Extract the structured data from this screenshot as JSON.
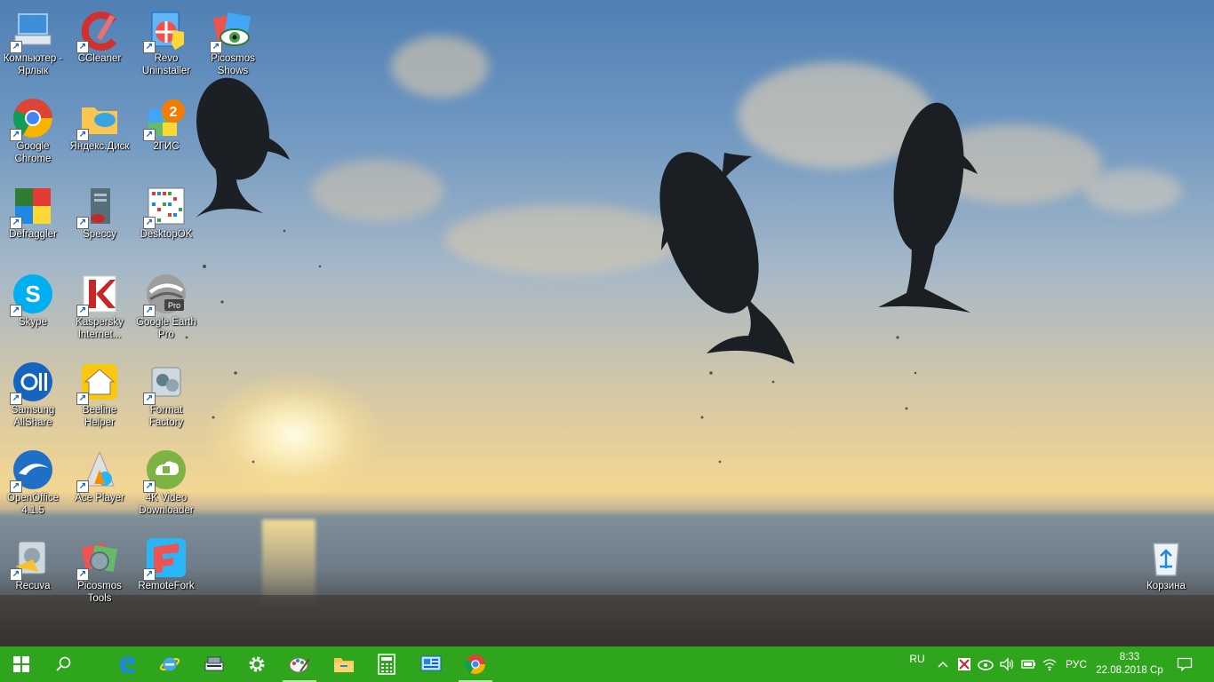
{
  "desktop": {
    "icons": [
      {
        "label": "Компьютер - Ярлык",
        "icon": "computer-icon"
      },
      {
        "label": "CCleaner",
        "icon": "ccleaner-icon"
      },
      {
        "label": "Revo Uninstaller",
        "icon": "revo-uninstaller-icon"
      },
      {
        "label": "Picosmos Shows",
        "icon": "picosmos-shows-icon"
      },
      {
        "label": "Google Chrome",
        "icon": "chrome-icon"
      },
      {
        "label": "Яндекс.Диск",
        "icon": "yandex-disk-icon"
      },
      {
        "label": "2ГИС",
        "icon": "2gis-icon"
      },
      {
        "label": "Defraggler",
        "icon": "defraggler-icon"
      },
      {
        "label": "Speccy",
        "icon": "speccy-icon"
      },
      {
        "label": "DesktopOK",
        "icon": "desktopok-icon"
      },
      {
        "label": "Skype",
        "icon": "skype-icon"
      },
      {
        "label": "Kaspersky Internet...",
        "icon": "kaspersky-icon"
      },
      {
        "label": "Google Earth Pro",
        "icon": "google-earth-pro-icon"
      },
      {
        "label": "Samsung AllShare",
        "icon": "samsung-allshare-icon"
      },
      {
        "label": "Beeline Helper",
        "icon": "beeline-helper-icon"
      },
      {
        "label": "Format Factory",
        "icon": "format-factory-icon"
      },
      {
        "label": "OpenOffice 4.1.5",
        "icon": "openoffice-icon"
      },
      {
        "label": "Ace Player",
        "icon": "ace-player-icon"
      },
      {
        "label": "4K Video Downloader",
        "icon": "4k-video-downloader-icon"
      },
      {
        "label": "Recuva",
        "icon": "recuva-icon"
      },
      {
        "label": "Picosmos Tools",
        "icon": "picosmos-tools-icon"
      },
      {
        "label": "RemoteFork",
        "icon": "remotefork-icon"
      },
      {
        "label": "Корзина",
        "icon": "recycle-bin-icon"
      }
    ]
  },
  "taskbar": {
    "color": "#2ea51c",
    "pinned": [
      {
        "name": "start-button",
        "icon": "windows-logo-icon"
      },
      {
        "name": "search-button",
        "icon": "search-icon"
      },
      {
        "name": "edge-button",
        "icon": "edge-icon"
      },
      {
        "name": "internet-explorer-button",
        "icon": "internet-explorer-icon"
      },
      {
        "name": "scanner-app-button",
        "icon": "scanner-icon"
      },
      {
        "name": "settings-button",
        "icon": "gear-icon"
      },
      {
        "name": "paint-app-button",
        "icon": "paint-icon"
      },
      {
        "name": "file-explorer-button",
        "icon": "folder-icon"
      },
      {
        "name": "calculator-button",
        "icon": "calculator-icon"
      },
      {
        "name": "control-panel-button",
        "icon": "control-panel-icon"
      },
      {
        "name": "chrome-button",
        "icon": "chrome-icon"
      }
    ],
    "tray": {
      "language_short": "RU",
      "language_indicator": "РУС",
      "time": "8:33",
      "date": "22.08.2018 Ср",
      "icons": [
        "show-hidden-icons-icon",
        "kaspersky-tray-icon",
        "network-manager-tray-icon",
        "volume-icon",
        "battery-icon",
        "wifi-icon"
      ]
    },
    "notifications_icon": "action-center-icon"
  }
}
